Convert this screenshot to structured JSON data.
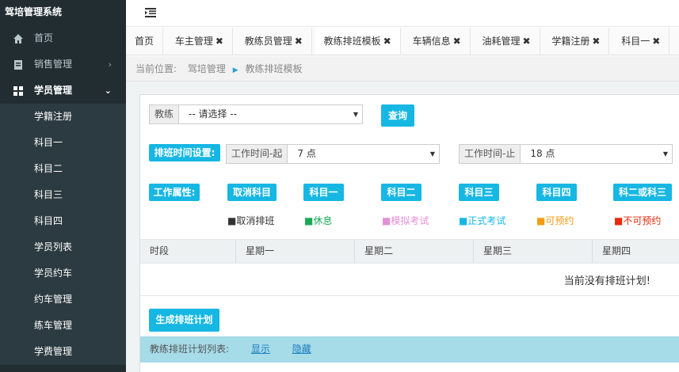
{
  "brand": "驾培管理系统",
  "sidebar": {
    "items": [
      {
        "label": "首页",
        "icon": "home-icon"
      },
      {
        "label": "销售管理",
        "icon": "document-icon",
        "chevron": "›"
      },
      {
        "label": "学员管理",
        "icon": "grid-icon",
        "chevron": "⌄"
      }
    ],
    "submenu": [
      "学籍注册",
      "科目一",
      "科目二",
      "科目三",
      "科目四",
      "学员列表",
      "学员约车",
      "约车管理",
      "练车管理",
      "学费管理"
    ]
  },
  "tabs": [
    {
      "label": "首页",
      "closable": false
    },
    {
      "label": "车主管理",
      "closable": true
    },
    {
      "label": "教练员管理",
      "closable": true
    },
    {
      "label": "教练排班模板",
      "closable": true,
      "active": true
    },
    {
      "label": "车辆信息",
      "closable": true
    },
    {
      "label": "油耗管理",
      "closable": true
    },
    {
      "label": "学籍注册",
      "closable": true
    },
    {
      "label": "科目一",
      "closable": true
    }
  ],
  "tab_close": "✖",
  "breadcrumb": {
    "prefix": "当前位置:",
    "parent": "驾培管理",
    "current": "教练排班模板"
  },
  "filter": {
    "coach_label": "教练",
    "coach_value": "-- 请选择 --",
    "query_button": "查询"
  },
  "schedule": {
    "section_label": "排班时间设置:",
    "start_label": "工作时间-起",
    "start_value": "7 点",
    "end_label": "工作时间-止",
    "end_value": "18 点"
  },
  "work_attr": {
    "label": "工作属性:",
    "buttons": [
      "取消科目",
      "科目一",
      "科目二",
      "科目三",
      "科目四",
      "科二或科三"
    ]
  },
  "legend": [
    {
      "label": "■取消排班",
      "color": "#333333"
    },
    {
      "label": "■休息",
      "color": "#1aaa55"
    },
    {
      "label": "■模拟考试",
      "color": "#e38fd6"
    },
    {
      "label": "■正式考试",
      "color": "#17b7e3"
    },
    {
      "label": "■可预约",
      "color": "#f39c12"
    },
    {
      "label": "■不可预约",
      "color": "#e8290b"
    }
  ],
  "table": {
    "columns": [
      "时段",
      "星期一",
      "星期二",
      "星期三",
      "星期四"
    ],
    "empty_message": "当前没有排班计划!"
  },
  "generate_button": "生成排班计划",
  "plan_list": {
    "label": "教练排班计划列表:",
    "show": "显示",
    "hide": "隐藏"
  },
  "colors": {
    "sidebar_bg": "#222d32",
    "accent": "#17b7e3",
    "list_bar": "#a6dbe8"
  }
}
